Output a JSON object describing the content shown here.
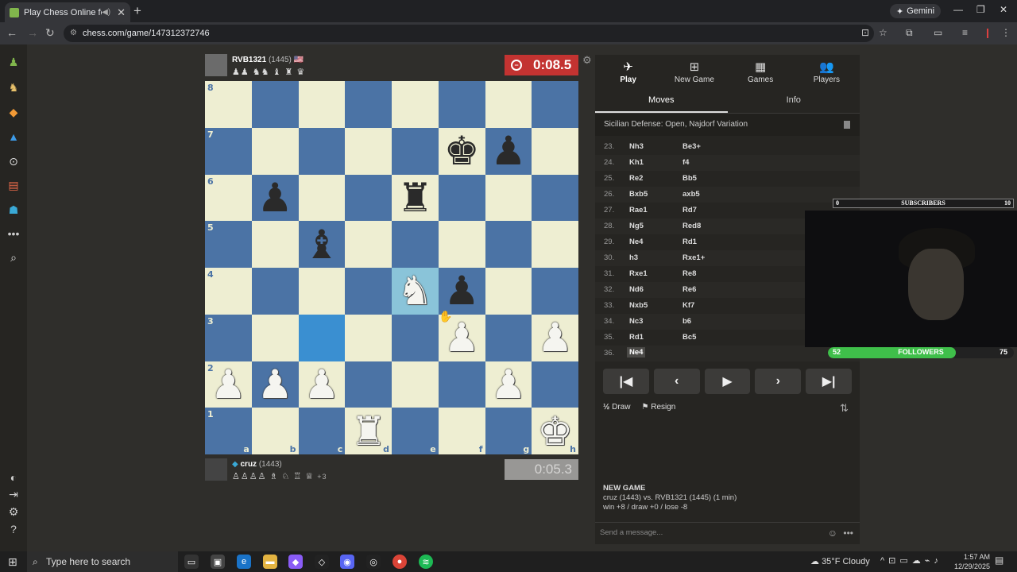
{
  "browser": {
    "tab_title": "Play Chess Online for FREE",
    "url": "chess.com/game/147312372746",
    "gemini_label": "Gemini"
  },
  "top_player": {
    "name": "RVB1321",
    "rating": "(1445)",
    "captured": "♟♟ ♞♞ ♝ ♜ ♛",
    "clock": "0:08.5"
  },
  "bottom_player": {
    "name": "cruz",
    "rating": "(1443)",
    "captured": "♙♙♙♙ ♗ ♘ ♖ ♕",
    "advantage": "+3",
    "clock": "0:05.3"
  },
  "board": {
    "ranks": [
      "8",
      "7",
      "6",
      "5",
      "4",
      "3",
      "2",
      "1"
    ],
    "files": [
      "a",
      "b",
      "c",
      "d",
      "e",
      "f",
      "g",
      "h"
    ],
    "pieces": [
      [
        "",
        "",
        "",
        "",
        "",
        "",
        "",
        ""
      ],
      [
        "",
        "",
        "",
        "",
        "",
        "k",
        "p",
        ""
      ],
      [
        "",
        "p",
        "",
        "",
        "r",
        "",
        "",
        ""
      ],
      [
        "",
        "",
        "b",
        "",
        "",
        "",
        "",
        ""
      ],
      [
        "",
        "",
        "",
        "",
        "N",
        "p",
        "",
        ""
      ],
      [
        "",
        "",
        "",
        "",
        "",
        "P",
        "",
        "P"
      ],
      [
        "P",
        "P",
        "P",
        "",
        "",
        "",
        "P",
        ""
      ],
      [
        "",
        "",
        "",
        "R",
        "",
        "",
        "",
        "K"
      ]
    ],
    "highlights": [
      "e4",
      "c3"
    ]
  },
  "panel": {
    "tabs": [
      {
        "label": "Play",
        "icon": "✈"
      },
      {
        "label": "New Game",
        "icon": "⊞"
      },
      {
        "label": "Games",
        "icon": "▦"
      },
      {
        "label": "Players",
        "icon": "👥"
      }
    ],
    "subtabs": [
      "Moves",
      "Info"
    ],
    "opening": "Sicilian Defense: Open, Najdorf Variation",
    "moves": [
      {
        "n": "23.",
        "w": "Nh3",
        "b": "Be3+"
      },
      {
        "n": "24.",
        "w": "Kh1",
        "b": "f4"
      },
      {
        "n": "25.",
        "w": "Re2",
        "b": "Bb5"
      },
      {
        "n": "26.",
        "w": "Bxb5",
        "b": "axb5"
      },
      {
        "n": "27.",
        "w": "Rae1",
        "b": "Rd7"
      },
      {
        "n": "28.",
        "w": "Ng5",
        "b": "Red8"
      },
      {
        "n": "29.",
        "w": "Ne4",
        "b": "Rd1"
      },
      {
        "n": "30.",
        "w": "h3",
        "b": "Rxe1+"
      },
      {
        "n": "31.",
        "w": "Rxe1",
        "b": "Re8"
      },
      {
        "n": "32.",
        "w": "Nd6",
        "b": "Re6"
      },
      {
        "n": "33.",
        "w": "Nxb5",
        "b": "Kf7"
      },
      {
        "n": "34.",
        "w": "Nc3",
        "b": "b6"
      },
      {
        "n": "35.",
        "w": "Rd1",
        "b": "Bc5"
      },
      {
        "n": "36.",
        "w": "Ne4",
        "b": ""
      }
    ],
    "draw_label": "Draw",
    "resign_label": "Resign",
    "new_game_heading": "NEW GAME",
    "new_game_line1": "cruz (1443) vs. RVB1321 (1445) (1 min)",
    "new_game_line2": "win +8 / draw +0 / lose -8",
    "chat_placeholder": "Send a message..."
  },
  "overlay": {
    "subscribers_label": "SUBSCRIBERS",
    "subscribers_left": "0",
    "subscribers_right": "10",
    "followers_label": "FOLLOWERS",
    "followers_current": "52",
    "followers_goal": "75",
    "followers_progress": 0.69
  },
  "taskbar": {
    "search_placeholder": "Type here to search",
    "weather": "35°F  Cloudy",
    "time": "1:57 AM",
    "date": "12/29/2025"
  }
}
